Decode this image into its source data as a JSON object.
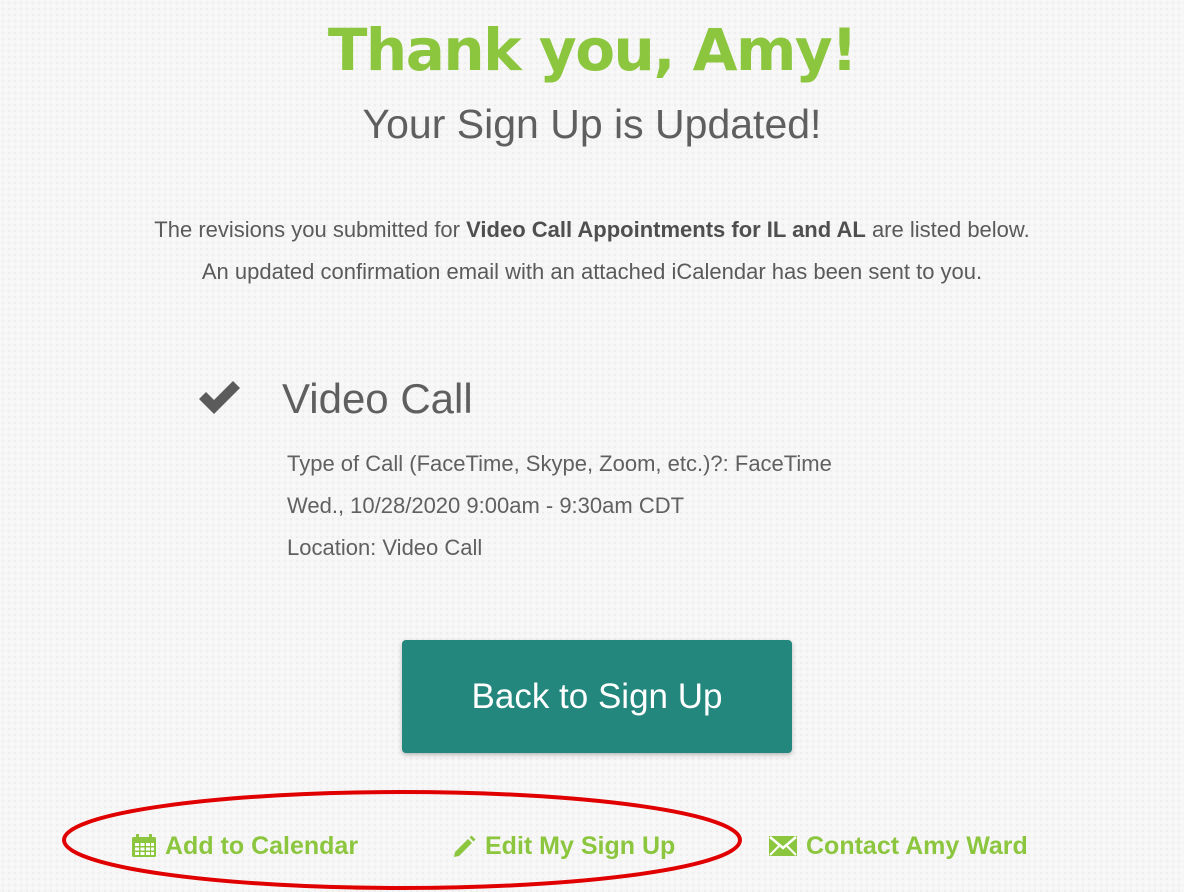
{
  "header": {
    "title": "Thank you, Amy!",
    "subtitle": "Your Sign Up is Updated!"
  },
  "message": {
    "line1_prefix": "The revisions you submitted for",
    "signup_name": "Video Call Appointments for IL and AL",
    "line1_suffix": "are listed below.",
    "line2": "An updated confirmation email with an attached iCalendar has been sent to you."
  },
  "slot": {
    "icon": "checkmark-icon",
    "title": "Video Call",
    "details": [
      "Type of Call (FaceTime, Skype, Zoom, etc.)?: FaceTime",
      "Wed., 10/28/2020 9:00am - 9:30am CDT",
      "Location: Video Call"
    ]
  },
  "actions": {
    "back_label": "Back to Sign Up"
  },
  "footer_links": [
    {
      "label": "Add to Calendar",
      "icon": "calendar-icon"
    },
    {
      "label": "Edit My Sign Up",
      "icon": "pencil-icon"
    },
    {
      "label": "Contact Amy Ward",
      "icon": "envelope-icon"
    }
  ],
  "colors": {
    "brand_green": "#8cc63f",
    "button_teal": "#24877d",
    "annotation_red": "#e00000"
  }
}
